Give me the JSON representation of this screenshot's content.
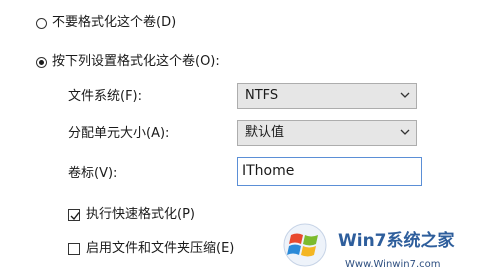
{
  "options": {
    "no_format_label": "不要格式化这个卷(D)",
    "format_label": "按下列设置格式化这个卷(O):",
    "no_format_selected": false,
    "format_selected": true
  },
  "filesystem": {
    "label": "文件系统(F):",
    "value": "NTFS"
  },
  "allocation": {
    "label": "分配单元大小(A):",
    "value": "默认值"
  },
  "volume": {
    "label": "卷标(V):",
    "value": "IThome"
  },
  "quick_format": {
    "label": "执行快速格式化(P)",
    "checked": true
  },
  "compression": {
    "label": "启用文件和文件夹压缩(E)",
    "checked": false
  },
  "watermark": {
    "text": "Win7系统之家",
    "url": "Www.Winwin7.com"
  }
}
